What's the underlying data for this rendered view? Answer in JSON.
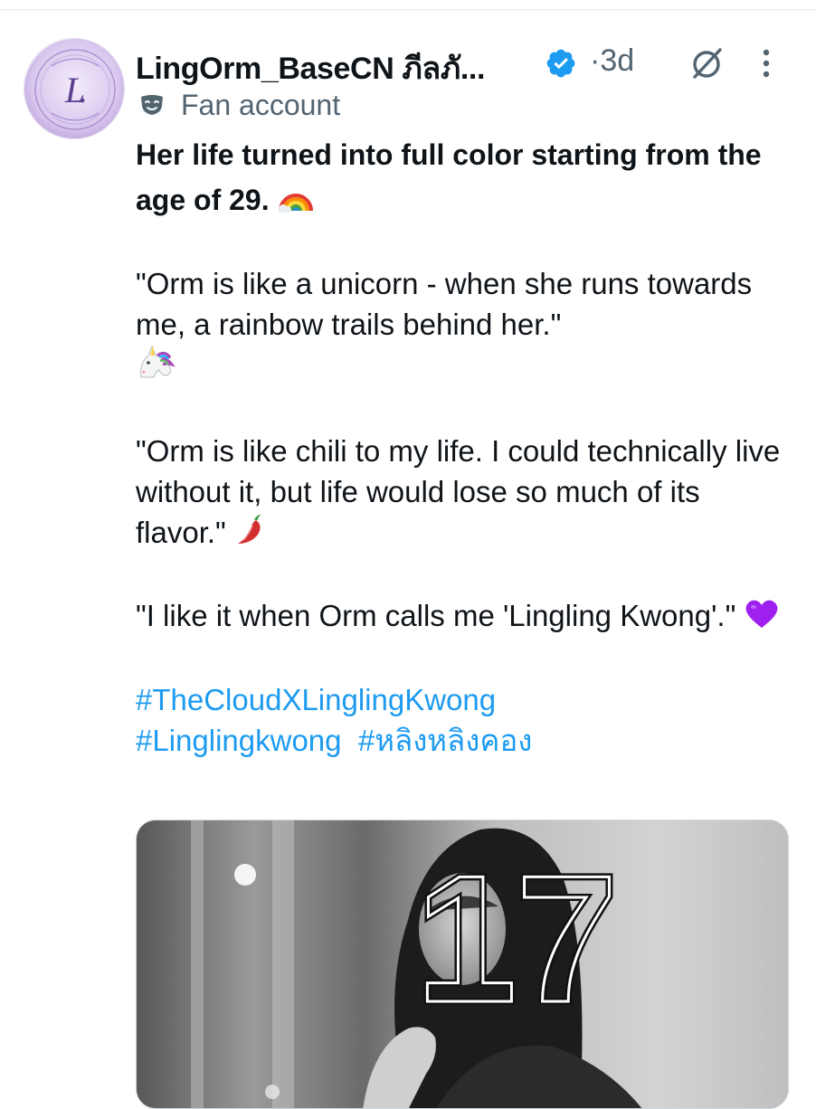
{
  "tweet": {
    "author": {
      "display_name": "LingOrm_BaseCN ภีลภั...",
      "verified": true,
      "avatar_icon": "lingorm-logo-avatar",
      "label": "Fan account",
      "label_icon": "theater-mask-icon"
    },
    "time": "·3d",
    "actions": {
      "grok_icon": "grok-icon",
      "more_icon": "more-vertical-icon"
    },
    "lead": "Her life turned into full color starting from the age of 29.",
    "quote1_a": "\"Orm is like a unicorn - when she runs towards me, a rainbow trails behind her.\"",
    "quote2": "\"Orm is like chili to my life. I could technically live without it, but life would lose so much of its flavor.\"",
    "quote3": "\"I like it when Orm calls me 'Lingling Kwong'.\"",
    "hashtags": [
      "#TheCloudXLinglingKwong",
      "#Linglingkwong",
      "#หลิงหลิงคอง"
    ],
    "media": {
      "overlay_text": "17",
      "type": "photo"
    }
  },
  "colors": {
    "link": "#1d9bf0",
    "secondary_text": "#536471",
    "verified": "#1d9bf0",
    "avatar_tint": "#c9b6e4"
  }
}
